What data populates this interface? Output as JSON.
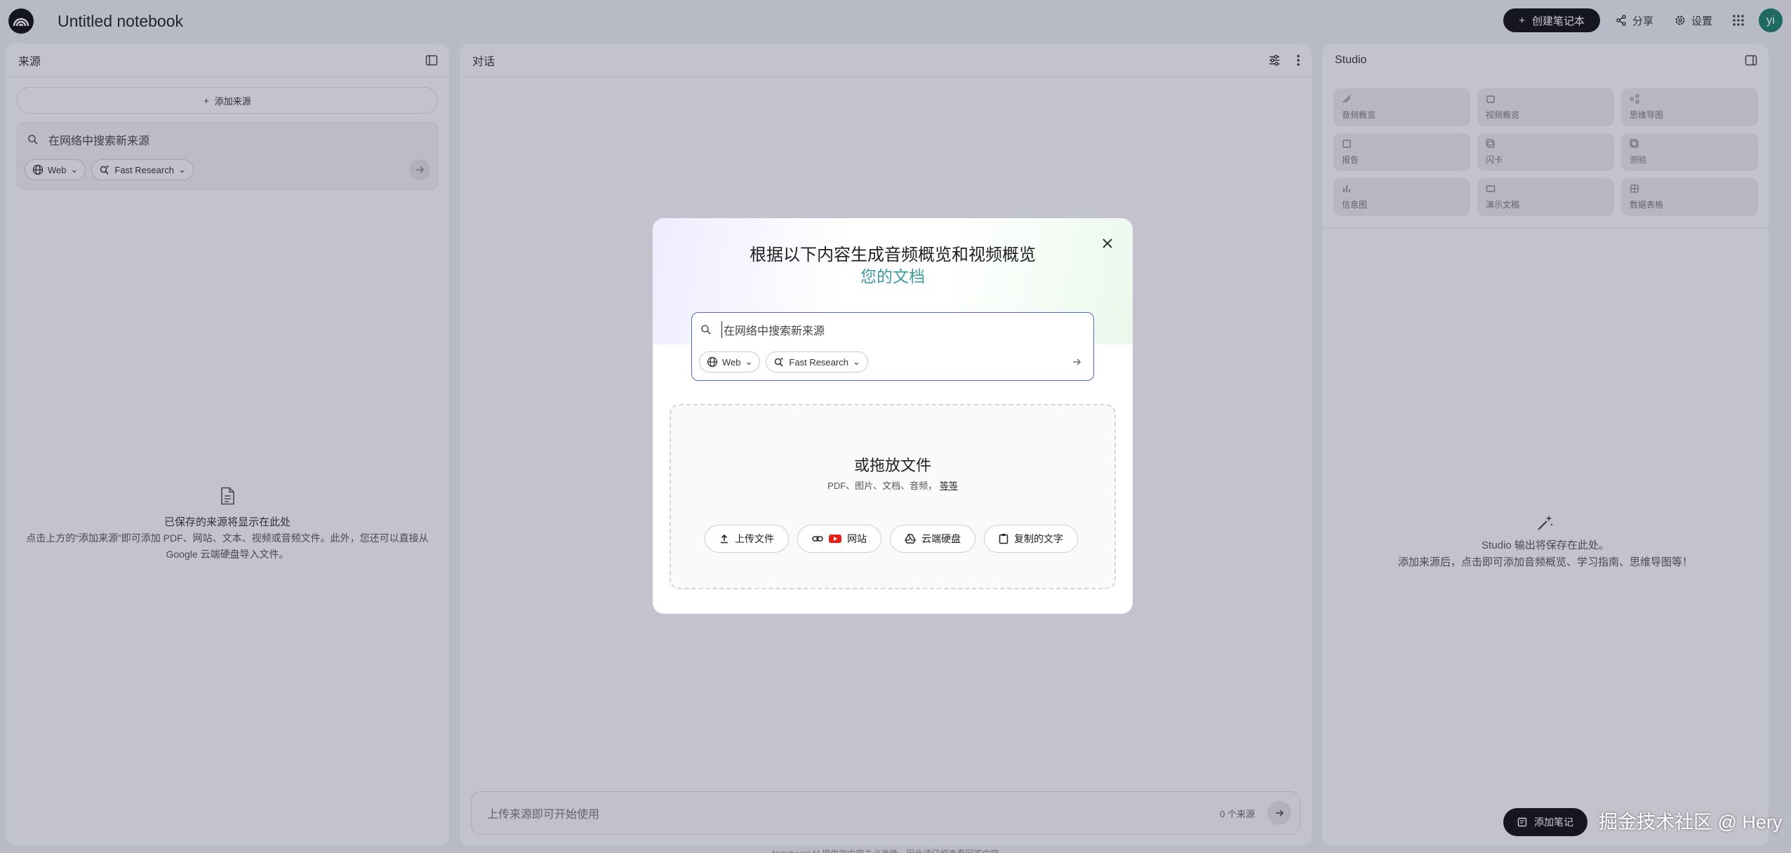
{
  "app": {
    "notebook_title": "Untitled notebook",
    "create_label": "创建笔记本",
    "share_label": "分享",
    "settings_label": "设置",
    "avatar_initials": "yi"
  },
  "sources": {
    "title": "来源",
    "add_label": "添加来源",
    "search_placeholder": "在网络中搜索新来源",
    "chip_web": "Web",
    "chip_research": "Fast Research",
    "empty_title": "已保存的来源将显示在此处",
    "empty_desc_1": "点击上方的“添加来源”即可添加 PDF、网站、文本、视频或音频文件。此外，您还可以直接从",
    "empty_desc_2": "Google 云端硬盘导入文件。"
  },
  "chat": {
    "title": "对话",
    "input_placeholder": "上传来源即可开始使用",
    "source_count": "0 个来源"
  },
  "studio": {
    "title": "Studio",
    "tiles": [
      "音频概览",
      "视频概览",
      "思维导图",
      "报告",
      "闪卡",
      "测验",
      "信息图",
      "演示文稿",
      "数据表格"
    ],
    "empty_title": "Studio 输出将保存在此处。",
    "empty_desc": "添加来源后，点击即可添加音频概览、学习指南、思维导图等！",
    "add_note_label": "添加笔记"
  },
  "modal": {
    "title": "根据以下内容生成音频概览和视频概览",
    "subtitle": "您的文档",
    "search_placeholder": "在网络中搜索新来源",
    "chip_web": "Web",
    "chip_research": "Fast Research",
    "drop_title": "或拖放文件",
    "drop_types": "PDF、图片、文档、音频，",
    "drop_more": "等等",
    "btn_upload": "上传文件",
    "btn_website": "网站",
    "btn_drive": "云端硬盘",
    "btn_paste": "复制的文字"
  },
  "watermark": "掘金技术社区 @ Hery",
  "footer_text": "NotebookLM 提供的内容未必准确，因此请仔细查看回答内容"
}
